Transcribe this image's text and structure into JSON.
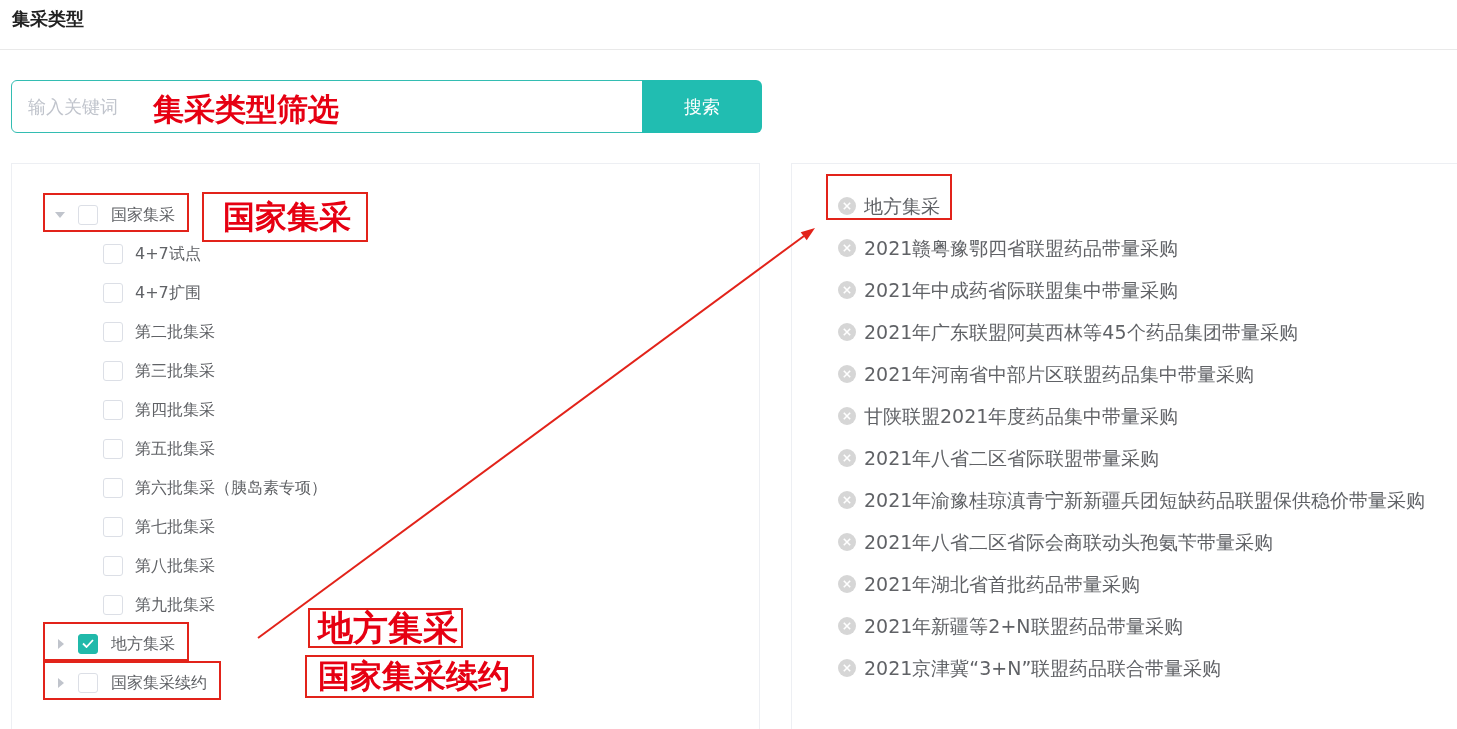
{
  "page_title": "集采类型",
  "search": {
    "placeholder": "输入关键词",
    "button": "搜索"
  },
  "tree": [
    {
      "label": "国家集采",
      "checked": false,
      "expanded": true,
      "highlighted": true,
      "children": [
        {
          "label": "4+7试点",
          "checked": false
        },
        {
          "label": "4+7扩围",
          "checked": false
        },
        {
          "label": "第二批集采",
          "checked": false
        },
        {
          "label": "第三批集采",
          "checked": false
        },
        {
          "label": "第四批集采",
          "checked": false
        },
        {
          "label": "第五批集采",
          "checked": false
        },
        {
          "label": "第六批集采（胰岛素专项）",
          "checked": false
        },
        {
          "label": "第七批集采",
          "checked": false
        },
        {
          "label": "第八批集采",
          "checked": false
        },
        {
          "label": "第九批集采",
          "checked": false
        }
      ]
    },
    {
      "label": "地方集采",
      "checked": true,
      "expanded": false,
      "highlighted": true
    },
    {
      "label": "国家集采续约",
      "checked": false,
      "expanded": false,
      "highlighted": true
    }
  ],
  "selected_list": [
    {
      "label": "地方集采",
      "highlighted": true
    },
    {
      "label": "2021赣粤豫鄂四省联盟药品带量采购",
      "highlighted": false
    },
    {
      "label": "2021年中成药省际联盟集中带量采购",
      "highlighted": false
    },
    {
      "label": "2021年广东联盟阿莫西林等45个药品集团带量采购",
      "highlighted": false
    },
    {
      "label": "2021年河南省中部片区联盟药品集中带量采购",
      "highlighted": false
    },
    {
      "label": "甘陕联盟2021年度药品集中带量采购",
      "highlighted": false
    },
    {
      "label": "2021年八省二区省际联盟带量采购",
      "highlighted": false
    },
    {
      "label": "2021年渝豫桂琼滇青宁新新疆兵团短缺药品联盟保供稳价带量采购",
      "highlighted": false
    },
    {
      "label": "2021年八省二区省际会商联动头孢氨苄带量采购",
      "highlighted": false
    },
    {
      "label": "2021年湖北省首批药品带量采购",
      "highlighted": false
    },
    {
      "label": "2021年新疆等2+N联盟药品带量采购",
      "highlighted": false
    },
    {
      "label": "2021京津冀“3+N”联盟药品联合带量采购",
      "highlighted": false
    }
  ],
  "annotations": [
    {
      "text": "集采类型筛选",
      "boxed": false
    },
    {
      "text": "国家集采",
      "boxed": true
    },
    {
      "text": "地方集采",
      "boxed": true
    },
    {
      "text": "国家集采续约",
      "boxed": true
    }
  ]
}
